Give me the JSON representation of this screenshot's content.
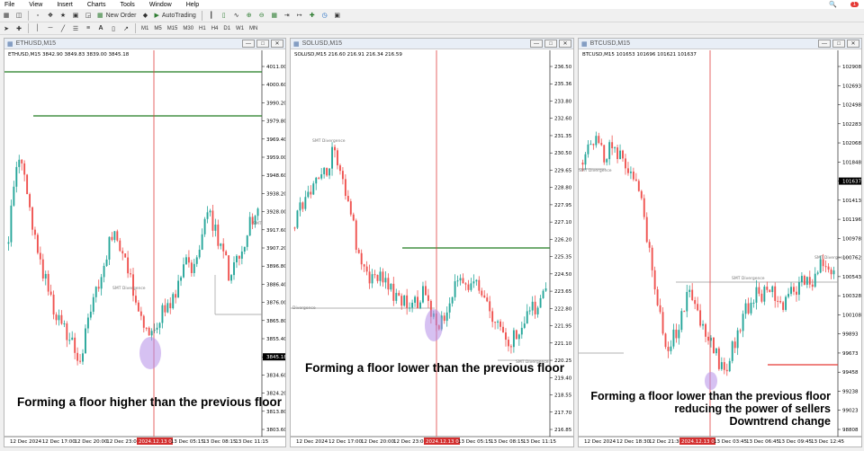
{
  "menu": {
    "items": [
      "File",
      "View",
      "Insert",
      "Charts",
      "Tools",
      "Window",
      "Help"
    ],
    "notification_count": "1"
  },
  "toolbar": {
    "new_order_label": "New Order",
    "autotrading_label": "AutoTrading",
    "timeframes": [
      "M1",
      "M5",
      "M15",
      "M30",
      "H1",
      "H4",
      "D1",
      "W1",
      "MN"
    ]
  },
  "colors": {
    "bull": "#26a69a",
    "bear": "#ef5350",
    "level": "#1f7a1f",
    "vline": "#e04040",
    "ellipse": "#b48ee8"
  },
  "windows": [
    {
      "title": "ETHUSD,M15",
      "symbol_line": "ETHUSD,M15",
      "ohlc_line": "3842.90 3849.83 3839.00 3845.18",
      "price_labels": [
        "4011.00",
        "4000.60",
        "3990.20",
        "3979.80",
        "3969.40",
        "3959.00",
        "3948.60",
        "3938.20",
        "3928.00",
        "3917.60",
        "3907.20",
        "3896.80",
        "3886.40",
        "3876.00",
        "3865.80",
        "3855.40",
        "3845.18",
        "3834.60",
        "3824.20",
        "3813.80",
        "3803.60"
      ],
      "current_price": "3845.18",
      "time_labels": [
        "12 Dec 2024",
        "12 Dec 17:00",
        "12 Dec 20:00",
        "12 Dec 23:00",
        "2024.12.13 02:45",
        "13 Dec 05:15",
        "13 Dec 08:15",
        "13 Dec 11:15"
      ],
      "highlight_time": "2024.12.13 02:45",
      "smt_labels": [
        "SMT Divergence",
        "SMT"
      ],
      "annotation": [
        "Forming a floor higher than the previous floor"
      ]
    },
    {
      "title": "SOLUSD,M15",
      "symbol_line": "SOLUSD,M15",
      "ohlc_line": "216.60 216.91 216.34 216.59",
      "price_labels": [
        "236.50",
        "235.36",
        "233.80",
        "232.60",
        "231.35",
        "230.50",
        "229.65",
        "228.80",
        "227.95",
        "227.10",
        "226.20",
        "225.35",
        "224.50",
        "223.65",
        "222.80",
        "221.95",
        "221.10",
        "220.25",
        "219.40",
        "218.55",
        "217.70",
        "216.85"
      ],
      "current_price": "216.59",
      "time_labels": [
        "12 Dec 2024",
        "12 Dec 17:00",
        "12 Dec 20:00",
        "12 Dec 23:00",
        "2024.12.13 02:45",
        "13 Dec 05:15",
        "13 Dec 08:15",
        "13 Dec 11:15"
      ],
      "highlight_time": "2024.12.13 02:45",
      "smt_labels": [
        "SMT Divergence",
        "Divergence",
        "SMT Divergence"
      ],
      "annotation": [
        "Forming a floor lower than the previous floor"
      ]
    },
    {
      "title": "BTCUSD,M15",
      "symbol_line": "BTCUSD,M15",
      "ohlc_line": "101653 101696 101621 101637",
      "price_labels": [
        "102908",
        "102693",
        "102498",
        "102283",
        "102068",
        "101848",
        "101637",
        "101413",
        "101196",
        "100978",
        "100762",
        "100543",
        "100328",
        "100108",
        "99893",
        "99673",
        "99458",
        "99238",
        "99023",
        "98808"
      ],
      "current_price": "101637",
      "time_labels": [
        "12 Dec 2024",
        "12 Dec 18:30",
        "12 Dec 21:30",
        "2024.12.13 02:45",
        "13 Dec 03:45",
        "13 Dec 06:45",
        "13 Dec 09:45",
        "13 Dec 12:45"
      ],
      "highlight_time": "2024.12.13 02:45",
      "smt_labels": [
        "SMT Divergence",
        "SMT Divergence",
        "SMT Divergence"
      ],
      "annotation": [
        "Forming a floor lower than the previous floor",
        "reducing the power of sellers",
        "Downtrend change"
      ]
    }
  ]
}
